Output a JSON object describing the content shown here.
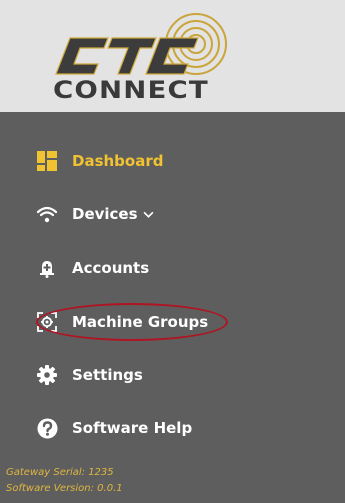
{
  "brand": {
    "logo_top": "CTC",
    "logo_bottom": "CONNECT",
    "accent_color": "#f1c232",
    "logo_bg_color": "#e3e3e3"
  },
  "sidebar": {
    "bg_color": "#5e5e5e",
    "items": [
      {
        "label": "Dashboard",
        "icon": "dashboard-icon",
        "active": true
      },
      {
        "label": "Devices",
        "icon": "wifi-icon",
        "dropdown": true
      },
      {
        "label": "Accounts",
        "icon": "account-icon"
      },
      {
        "label": "Machine Groups",
        "icon": "machine-groups-icon",
        "highlighted": true
      },
      {
        "label": "Settings",
        "icon": "gear-icon"
      },
      {
        "label": "Software Help",
        "icon": "help-icon"
      }
    ]
  },
  "footer": {
    "gateway_serial": "Gateway Serial: 1235",
    "software_version": "Software Version: 0.0.1"
  },
  "annotation": {
    "color": "#b01422"
  }
}
